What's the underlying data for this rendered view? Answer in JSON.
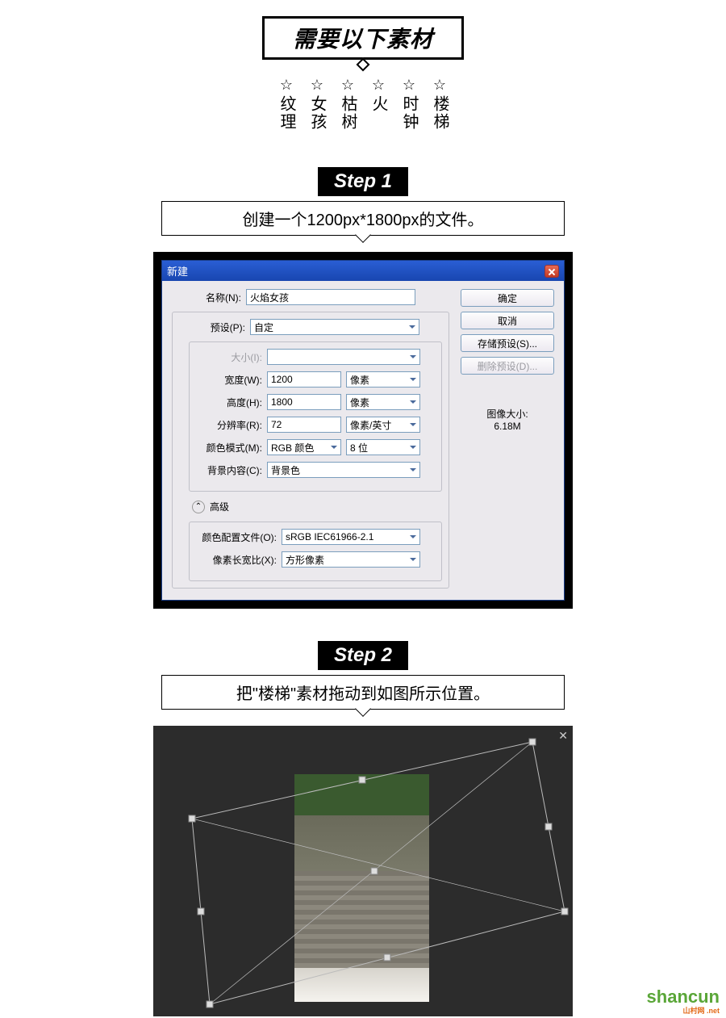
{
  "materials": {
    "title": "需要以下素材",
    "items": [
      {
        "star": "☆",
        "label": "纹理"
      },
      {
        "star": "☆",
        "label": "女孩"
      },
      {
        "star": "☆",
        "label": "枯树"
      },
      {
        "star": "☆",
        "label": "火"
      },
      {
        "star": "☆",
        "label": "时钟"
      },
      {
        "star": "☆",
        "label": "楼梯"
      }
    ]
  },
  "step1": {
    "badge": "Step 1",
    "desc": "创建一个1200px*1800px的文件。"
  },
  "dialog": {
    "title": "新建",
    "labels": {
      "name": "名称(N):",
      "preset": "预设(P):",
      "size": "大小(I):",
      "width": "宽度(W):",
      "height": "高度(H):",
      "res": "分辨率(R):",
      "mode": "颜色模式(M):",
      "bg": "背景内容(C):",
      "adv": "高级",
      "profile": "颜色配置文件(O):",
      "aspect": "像素长宽比(X):"
    },
    "values": {
      "name": "火焰女孩",
      "preset": "自定",
      "width": "1200",
      "height": "1800",
      "res": "72",
      "mode": "RGB 颜色",
      "bits": "8 位",
      "bg": "背景色",
      "profile": "sRGB IEC61966-2.1",
      "aspect": "方形像素",
      "unit_px": "像素",
      "unit_res": "像素/英寸"
    },
    "buttons": {
      "ok": "确定",
      "cancel": "取消",
      "save": "存储预设(S)...",
      "delete": "删除预设(D)..."
    },
    "imgsize": {
      "label": "图像大小:",
      "value": "6.18M"
    },
    "adv_icon": "⌃"
  },
  "step2": {
    "badge": "Step 2",
    "desc": "把\"楼梯\"素材拖动到如图所示位置。",
    "close": "✕"
  },
  "watermark": {
    "text": "shancun",
    "sub": "山村网",
    "net": ".net"
  }
}
